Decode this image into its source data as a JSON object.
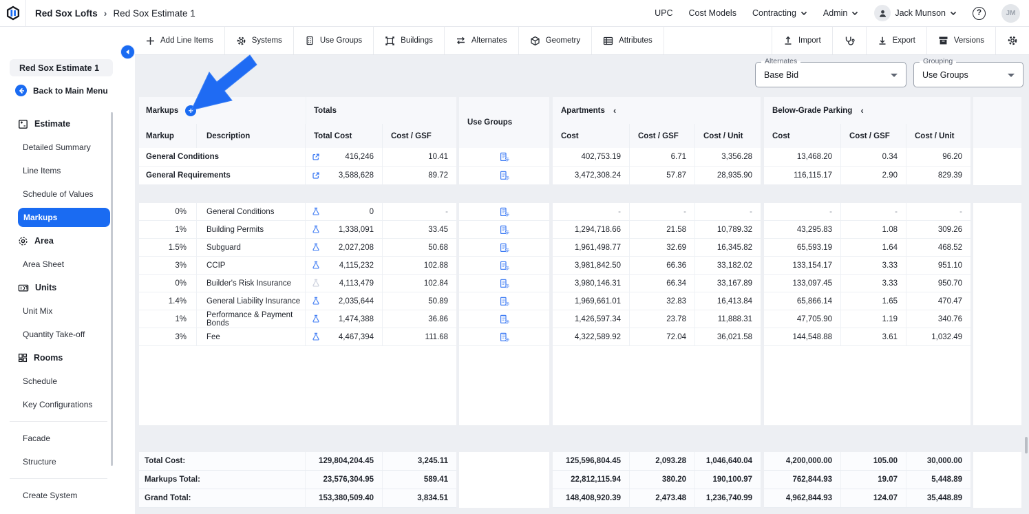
{
  "topbar": {
    "breadcrumb": [
      "Red Sox Lofts",
      "Red Sox Estimate 1"
    ],
    "nav": [
      "UPC",
      "Cost Models",
      "Contracting",
      "Admin"
    ],
    "user_name": "Jack Munson",
    "user_initials": "JM",
    "help_glyph": "?"
  },
  "toolbar": {
    "left": [
      {
        "label": "Add Line Items",
        "icon": "plus-icon"
      },
      {
        "label": "Systems",
        "icon": "gears-icon"
      },
      {
        "label": "Use Groups",
        "icon": "building-icon"
      },
      {
        "label": "Buildings",
        "icon": "frame-icon"
      },
      {
        "label": "Alternates",
        "icon": "swap-arrows-icon"
      },
      {
        "label": "Geometry",
        "icon": "cube-icon"
      },
      {
        "label": "Attributes",
        "icon": "table-icon"
      }
    ],
    "right": [
      {
        "label": "Import",
        "icon": "upload-icon"
      },
      {
        "label": "",
        "icon": "stethoscope-icon"
      },
      {
        "label": "Export",
        "icon": "download-icon"
      },
      {
        "label": "Versions",
        "icon": "archive-icon"
      },
      {
        "label": "",
        "icon": "gear-icon"
      }
    ]
  },
  "sidebar": {
    "title": "Red Sox Estimate 1",
    "back_label": "Back to Main Menu",
    "items": [
      {
        "kind": "header",
        "label": "Estimate",
        "icon": "estimate-icon"
      },
      {
        "kind": "item",
        "label": "Detailed Summary"
      },
      {
        "kind": "item",
        "label": "Line Items"
      },
      {
        "kind": "item",
        "label": "Schedule of Values"
      },
      {
        "kind": "item",
        "label": "Markups",
        "active": true
      },
      {
        "kind": "header",
        "label": "Area",
        "icon": "area-icon"
      },
      {
        "kind": "item",
        "label": "Area Sheet"
      },
      {
        "kind": "header",
        "label": "Units",
        "icon": "units-icon"
      },
      {
        "kind": "item",
        "label": "Unit Mix"
      },
      {
        "kind": "item",
        "label": "Quantity Take-off"
      },
      {
        "kind": "header",
        "label": "Rooms",
        "icon": "rooms-icon"
      },
      {
        "kind": "item",
        "label": "Schedule"
      },
      {
        "kind": "item",
        "label": "Key Configurations"
      },
      {
        "kind": "divider"
      },
      {
        "kind": "item",
        "label": "Facade"
      },
      {
        "kind": "item",
        "label": "Structure"
      },
      {
        "kind": "divider"
      },
      {
        "kind": "item",
        "label": "Create System"
      }
    ]
  },
  "filters": {
    "alternates": {
      "label": "Alternates",
      "value": "Base Bid"
    },
    "grouping": {
      "label": "Grouping",
      "value": "Use Groups"
    }
  },
  "icons": {
    "add_markup": "+",
    "collapse_group": "‹",
    "breadcrumb_sep": "›"
  },
  "table": {
    "groups": {
      "markups": "Markups",
      "totals": "Totals",
      "use_groups": "Use Groups",
      "apartments": "Apartments",
      "below_grade_parking": "Below-Grade Parking"
    },
    "columns": {
      "markup": "Markup",
      "description": "Description",
      "total_cost": "Total Cost",
      "cost_gsf": "Cost / GSF",
      "cost": "Cost",
      "cost_unit": "Cost / Unit"
    },
    "summary_rows": [
      {
        "name": "General Conditions",
        "tc": "416,246",
        "gsf": "10.41",
        "a_cost": "402,753.19",
        "a_gsf": "6.71",
        "a_unit": "3,356.28",
        "b_cost": "13,468.20",
        "b_gsf": "0.34",
        "b_unit": "96.20"
      },
      {
        "name": "General Requirements",
        "tc": "3,588,628",
        "gsf": "89.72",
        "a_cost": "3,472,308.24",
        "a_gsf": "57.87",
        "a_unit": "28,935.90",
        "b_cost": "116,115.17",
        "b_gsf": "2.90",
        "b_unit": "829.39"
      }
    ],
    "markup_rows": [
      {
        "pct": "0%",
        "desc": "General Conditions",
        "flask_active": true,
        "tc": "0",
        "gsf": "-",
        "a_cost": "-",
        "a_gsf": "-",
        "a_unit": "-",
        "b_cost": "-",
        "b_gsf": "-",
        "b_unit": "-"
      },
      {
        "pct": "1%",
        "desc": "Building Permits",
        "flask_active": true,
        "tc": "1,338,091",
        "gsf": "33.45",
        "a_cost": "1,294,718.66",
        "a_gsf": "21.58",
        "a_unit": "10,789.32",
        "b_cost": "43,295.83",
        "b_gsf": "1.08",
        "b_unit": "309.26"
      },
      {
        "pct": "1.5%",
        "desc": "Subguard",
        "flask_active": true,
        "tc": "2,027,208",
        "gsf": "50.68",
        "a_cost": "1,961,498.77",
        "a_gsf": "32.69",
        "a_unit": "16,345.82",
        "b_cost": "65,593.19",
        "b_gsf": "1.64",
        "b_unit": "468.52"
      },
      {
        "pct": "3%",
        "desc": "CCIP",
        "flask_active": true,
        "tc": "4,115,232",
        "gsf": "102.88",
        "a_cost": "3,981,842.50",
        "a_gsf": "66.36",
        "a_unit": "33,182.02",
        "b_cost": "133,154.17",
        "b_gsf": "3.33",
        "b_unit": "951.10"
      },
      {
        "pct": "0%",
        "desc": "Builder's Risk Insurance",
        "flask_active": false,
        "tc": "4,113,479",
        "gsf": "102.84",
        "a_cost": "3,980,146.31",
        "a_gsf": "66.34",
        "a_unit": "33,167.89",
        "b_cost": "133,097.45",
        "b_gsf": "3.33",
        "b_unit": "950.70"
      },
      {
        "pct": "1.4%",
        "desc": "General Liability Insurance",
        "flask_active": true,
        "tc": "2,035,644",
        "gsf": "50.89",
        "a_cost": "1,969,661.01",
        "a_gsf": "32.83",
        "a_unit": "16,413.84",
        "b_cost": "65,866.14",
        "b_gsf": "1.65",
        "b_unit": "470.47"
      },
      {
        "pct": "1%",
        "desc": "Performance & Payment Bonds",
        "flask_active": true,
        "tc": "1,474,388",
        "gsf": "36.86",
        "a_cost": "1,426,597.34",
        "a_gsf": "23.78",
        "a_unit": "11,888.31",
        "b_cost": "47,705.90",
        "b_gsf": "1.19",
        "b_unit": "340.76"
      },
      {
        "pct": "3%",
        "desc": "Fee",
        "flask_active": true,
        "tc": "4,467,394",
        "gsf": "111.68",
        "a_cost": "4,322,589.92",
        "a_gsf": "72.04",
        "a_unit": "36,021.58",
        "b_cost": "144,548.88",
        "b_gsf": "3.61",
        "b_unit": "1,032.49"
      }
    ],
    "totals_rows": [
      {
        "label": "Total Cost:",
        "tc": "129,804,204.45",
        "gsf": "3,245.11",
        "a_cost": "125,596,804.45",
        "a_gsf": "2,093.28",
        "a_unit": "1,046,640.04",
        "b_cost": "4,200,000.00",
        "b_gsf": "105.00",
        "b_unit": "30,000.00"
      },
      {
        "label": "Markups Total:",
        "tc": "23,576,304.95",
        "gsf": "589.41",
        "a_cost": "22,812,115.94",
        "a_gsf": "380.20",
        "a_unit": "190,100.97",
        "b_cost": "762,844.93",
        "b_gsf": "19.07",
        "b_unit": "5,448.89"
      },
      {
        "label": "Grand Total:",
        "tc": "153,380,509.40",
        "gsf": "3,834.51",
        "a_cost": "148,408,920.39",
        "a_gsf": "2,473.48",
        "a_unit": "1,236,740.99",
        "b_cost": "4,962,844.93",
        "b_gsf": "124.07",
        "b_unit": "35,448.89"
      }
    ]
  }
}
